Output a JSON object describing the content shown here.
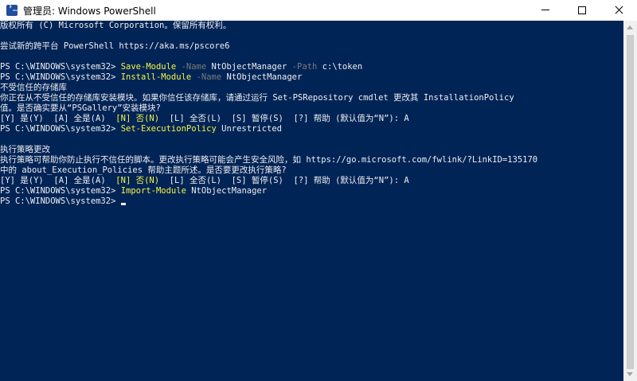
{
  "window": {
    "title": "管理员: Windows PowerShell",
    "controls": {
      "minimize": "minimize",
      "maximize": "maximize",
      "close": "close"
    }
  },
  "console": {
    "lines": [
      {
        "segments": [
          {
            "text": "版权所有 (C) Microsoft Corporation。保留所有权利。",
            "style": "pre"
          }
        ]
      },
      {
        "segments": []
      },
      {
        "segments": [
          {
            "text": "尝试新的跨平台 PowerShell https://aka.ms/pscore6",
            "style": "pre"
          }
        ]
      },
      {
        "segments": []
      },
      {
        "segments": [
          {
            "text": "PS C:\\WINDOWS\\system32> ",
            "style": "pre"
          },
          {
            "text": "Save-Module",
            "style": "cmd"
          },
          {
            "text": " -Name",
            "style": "param"
          },
          {
            "text": " NtObjectManager",
            "style": "arg"
          },
          {
            "text": " -Path",
            "style": "param"
          },
          {
            "text": " c:\\token",
            "style": "arg"
          }
        ]
      },
      {
        "segments": [
          {
            "text": "PS C:\\WINDOWS\\system32> ",
            "style": "pre"
          },
          {
            "text": "Install-Module",
            "style": "cmd"
          },
          {
            "text": " -Name",
            "style": "param"
          },
          {
            "text": " NtObjectManager",
            "style": "arg"
          }
        ]
      },
      {
        "segments": [
          {
            "text": "不受信任的存储库",
            "style": "pre"
          }
        ]
      },
      {
        "segments": [
          {
            "text": "你正在从不受信任的存储库安装模块。如果你信任该存储库，请通过运行 Set-PSRepository cmdlet 更改其 InstallationPolicy",
            "style": "pre"
          }
        ]
      },
      {
        "segments": [
          {
            "text": "值。是否确实要从“PSGallery”安装模块?",
            "style": "pre"
          }
        ]
      },
      {
        "segments": [
          {
            "text": "[Y] 是(Y)  [A] 全是(A)  ",
            "style": "pre"
          },
          {
            "text": "[N] 否(N)",
            "style": "warn-choice"
          },
          {
            "text": "  [L] 全否(L)  [S] 暂停(S)  [?] 帮助 (默认值为“N”): A",
            "style": "pre"
          }
        ]
      },
      {
        "segments": [
          {
            "text": "PS C:\\WINDOWS\\system32> ",
            "style": "pre"
          },
          {
            "text": "Set-ExecutionPolicy",
            "style": "cmd"
          },
          {
            "text": " Unrestricted",
            "style": "arg"
          }
        ]
      },
      {
        "segments": []
      },
      {
        "segments": [
          {
            "text": "执行策略更改",
            "style": "pre"
          }
        ]
      },
      {
        "segments": [
          {
            "text": "执行策略可帮助你防止执行不信任的脚本。更改执行策略可能会产生安全风险，如 https://go.microsoft.com/fwlink/?LinkID=135170",
            "style": "pre"
          }
        ]
      },
      {
        "segments": [
          {
            "text": "中的 about_Execution_Policies 帮助主题所述。是否要更改执行策略?",
            "style": "pre"
          }
        ]
      },
      {
        "segments": [
          {
            "text": "[Y] 是(Y)  [A] 全是(A)  ",
            "style": "pre"
          },
          {
            "text": "[N] 否(N)",
            "style": "warn-choice"
          },
          {
            "text": "  [L] 全否(L)  [S] 暂停(S)  [?] 帮助 (默认值为“N”): A",
            "style": "pre"
          }
        ]
      },
      {
        "segments": [
          {
            "text": "PS C:\\WINDOWS\\system32> ",
            "style": "pre"
          },
          {
            "text": "Import-Module",
            "style": "cmd"
          },
          {
            "text": " NtObjectManager",
            "style": "arg"
          }
        ]
      },
      {
        "segments": [
          {
            "text": "PS C:\\WINDOWS\\system32> ",
            "style": "pre"
          }
        ],
        "cursor": true
      }
    ]
  },
  "colors": {
    "background": "#012456",
    "foreground": "#eeedf0",
    "command": "#f5f543",
    "parameter": "#7a7a7a"
  }
}
